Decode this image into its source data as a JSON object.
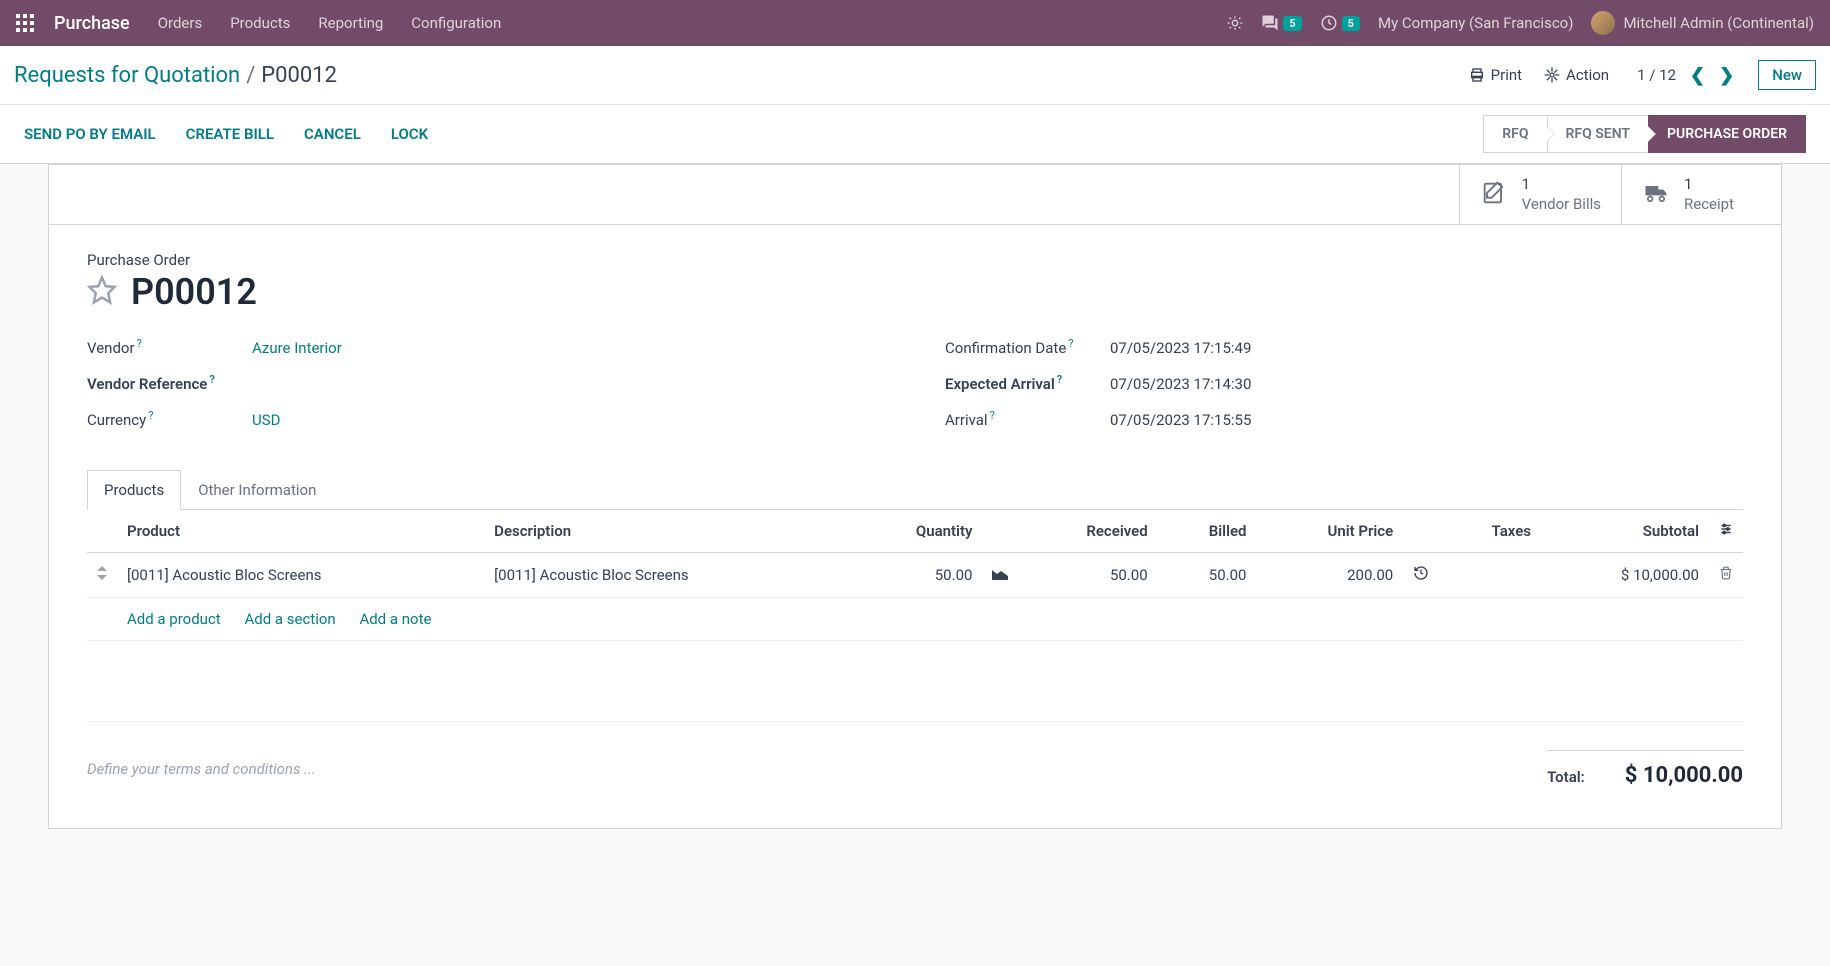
{
  "topnav": {
    "brand": "Purchase",
    "menu": [
      "Orders",
      "Products",
      "Reporting",
      "Configuration"
    ],
    "messages_badge": "5",
    "activities_badge": "5",
    "company": "My Company (San Francisco)",
    "user": "Mitchell Admin (Continental)"
  },
  "breadcrumb": {
    "parent": "Requests for Quotation",
    "current": "P00012",
    "print": "Print",
    "action": "Action",
    "pager": "1 / 12",
    "new_btn": "New"
  },
  "actionbar": {
    "send": "SEND PO BY EMAIL",
    "create_bill": "CREATE BILL",
    "cancel": "CANCEL",
    "lock": "LOCK",
    "statuses": {
      "rfq": "RFQ",
      "sent": "RFQ SENT",
      "po": "PURCHASE ORDER"
    }
  },
  "stats": {
    "bills_count": "1",
    "bills_label": "Vendor Bills",
    "receipt_count": "1",
    "receipt_label": "Receipt"
  },
  "record": {
    "type_label": "Purchase Order",
    "name": "P00012",
    "labels": {
      "vendor": "Vendor",
      "vendor_ref": "Vendor Reference",
      "currency": "Currency",
      "confirmation": "Confirmation Date",
      "expected": "Expected Arrival",
      "arrival": "Arrival"
    },
    "vendor": "Azure Interior",
    "vendor_ref": "",
    "currency": "USD",
    "confirmation_date": "07/05/2023 17:15:49",
    "expected_arrival": "07/05/2023 17:14:30",
    "arrival": "07/05/2023 17:15:55"
  },
  "tabs": {
    "products": "Products",
    "other": "Other Information"
  },
  "table": {
    "headers": {
      "product": "Product",
      "description": "Description",
      "quantity": "Quantity",
      "received": "Received",
      "billed": "Billed",
      "unit_price": "Unit Price",
      "taxes": "Taxes",
      "subtotal": "Subtotal"
    },
    "rows": [
      {
        "product": "[0011] Acoustic Bloc Screens",
        "description": "[0011] Acoustic Bloc Screens",
        "quantity": "50.00",
        "received": "50.00",
        "billed": "50.00",
        "unit_price": "200.00",
        "taxes": "",
        "subtotal": "$ 10,000.00"
      }
    ],
    "add_product": "Add a product",
    "add_section": "Add a section",
    "add_note": "Add a note"
  },
  "footer": {
    "terms_placeholder": "Define your terms and conditions ...",
    "total_label": "Total:",
    "total_value": "$ 10,000.00"
  }
}
